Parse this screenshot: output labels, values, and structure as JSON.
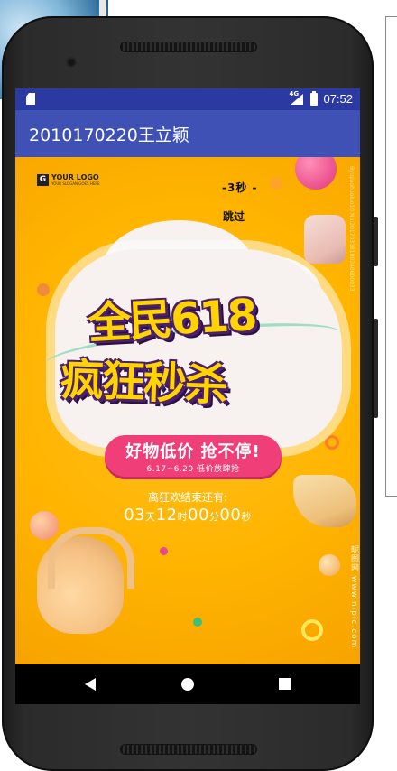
{
  "status_bar": {
    "network_tag": "4G",
    "time": "07:52"
  },
  "app_bar": {
    "title": "2010170220王立颖"
  },
  "splash": {
    "countdown_text": "-3秒  -",
    "skip_label": "跳过",
    "logo_text": "YOUR LOGO",
    "logo_slogan": "YOUR SLOGAN GOES HERE",
    "logo_letter": "G",
    "headline_line1": "全民618",
    "headline_line2": "疯狂秒杀",
    "pill_main": "好物低价  抢不停!",
    "pill_sub": "6.17~6.20  低价放肆抢",
    "ends_label": "离狂欢结束还有:",
    "countdown_days": "03",
    "countdown_days_unit": "天",
    "countdown_hours": "12",
    "countdown_hours_unit": "时",
    "countdown_minutes": "00",
    "countdown_minutes_unit": "分",
    "countdown_seconds": "00",
    "countdown_seconds_unit": "秒",
    "watermark": "昵图网 www.nipic.com",
    "watermark_id": "By:qiaohuoluo10 No:20170318180240600033"
  },
  "colors": {
    "status_bar": "#2b3aa3",
    "app_bar": "#3f51b5",
    "poster_bg": "#ffb400",
    "pill": "#ef3e78"
  },
  "nav_bar": {
    "back": "back-icon",
    "home": "home-icon",
    "recents": "recents-icon"
  }
}
